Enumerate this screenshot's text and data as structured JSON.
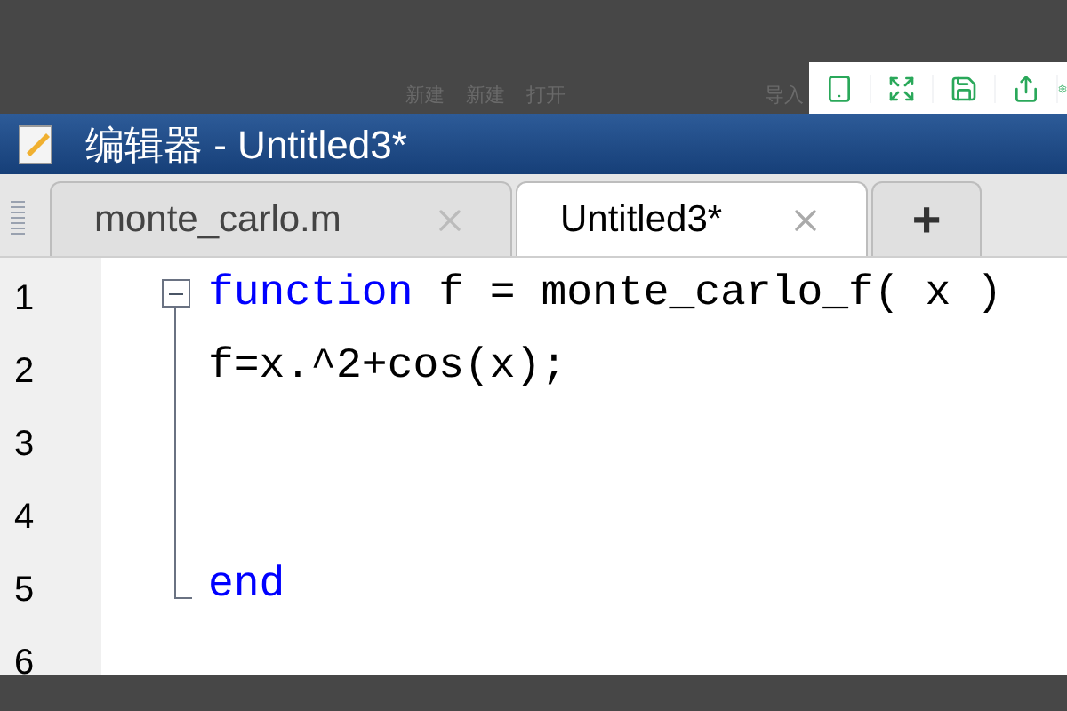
{
  "background_toolbar": [
    "新建",
    "新建",
    "打开",
    "导入"
  ],
  "window": {
    "title": "编辑器 - Untitled3*"
  },
  "tabs": [
    {
      "label": "monte_carlo.m",
      "selected": false
    },
    {
      "label": "Untitled3*",
      "selected": true
    }
  ],
  "new_tab": "+",
  "lines": [
    {
      "number": "1",
      "kind": "start",
      "tokens": [
        {
          "text": "function",
          "kind": "keyword"
        },
        {
          "text": " f = monte_carlo_f( x )",
          "kind": "plain"
        }
      ]
    },
    {
      "number": "2",
      "kind": "inside",
      "tokens": [
        {
          "text": "f=x.^2+cos(x);",
          "kind": "plain"
        }
      ]
    },
    {
      "number": "3",
      "kind": "inside"
    },
    {
      "number": "4",
      "kind": "inside"
    },
    {
      "number": "5",
      "kind": "end",
      "tokens": [
        {
          "text": "end",
          "kind": "keyword"
        }
      ]
    },
    {
      "number": "6",
      "kind": "plain"
    }
  ]
}
